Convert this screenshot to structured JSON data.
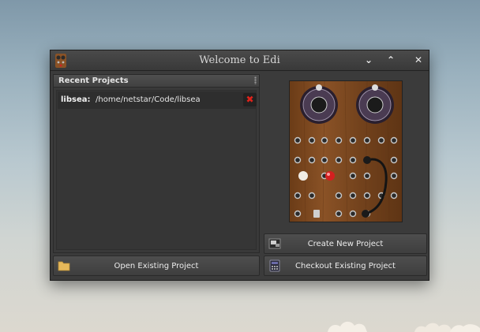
{
  "window": {
    "title": "Welcome to Edi",
    "icons": [
      "app-icon",
      "minimize-icon",
      "maximize-icon",
      "close-icon"
    ]
  },
  "recent_projects": {
    "header": "Recent Projects",
    "items": [
      {
        "name": "libsea:",
        "path": "/home/netstar/Code/libsea",
        "remove_icon": "remove-icon"
      }
    ]
  },
  "image": {
    "description_icon": "switchboard-image"
  },
  "buttons": {
    "create_new": "Create New Project",
    "open_existing": "Open Existing Project",
    "checkout_existing": "Checkout Existing Project"
  },
  "colors": {
    "window_bg": "#3b3b3b",
    "remove_red": "#e0221a",
    "wood": "#7a4a22"
  }
}
